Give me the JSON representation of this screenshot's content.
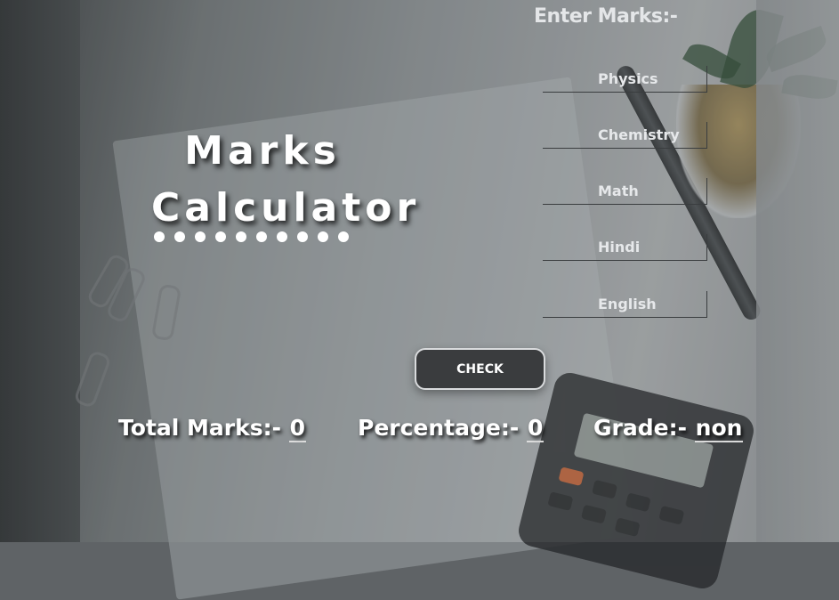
{
  "title": {
    "line1": "Marks",
    "line2": "Calculator"
  },
  "form": {
    "heading": "Enter Marks:-",
    "fields": [
      {
        "placeholder": "Physics"
      },
      {
        "placeholder": "Chemistry"
      },
      {
        "placeholder": "Math"
      },
      {
        "placeholder": "Hindi"
      },
      {
        "placeholder": "English"
      }
    ],
    "check_label": "CHECK"
  },
  "results": {
    "total_label": "Total Marks:- ",
    "total_value": "0",
    "percentage_label": "Percentage:- ",
    "percentage_value": "0",
    "grade_label": "Grade:- ",
    "grade_value": "non"
  },
  "colors": {
    "button_bg": "#3a3c3e",
    "text": "#ffffff"
  }
}
